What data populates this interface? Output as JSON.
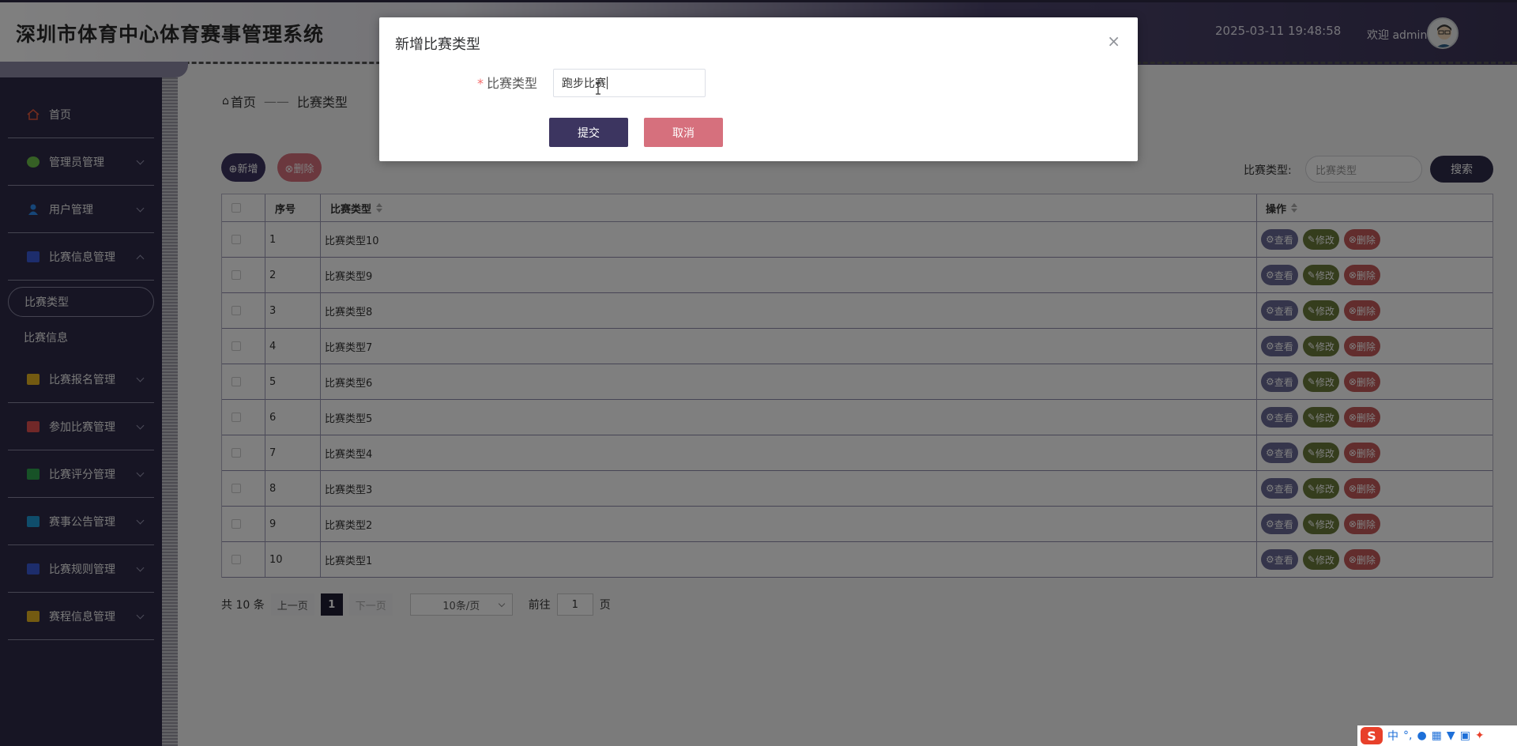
{
  "header": {
    "title": "深圳市体育中心体育赛事管理系统",
    "datetime": "2025-03-11 19:48:58",
    "welcome": "欢迎 admin"
  },
  "sidebar": {
    "items": [
      {
        "label": "首页",
        "icon": "home-icon",
        "color": "#e8593c"
      },
      {
        "label": "管理员管理",
        "icon": "gear-icon",
        "color": "#6cc04a"
      },
      {
        "label": "用户管理",
        "icon": "user-icon",
        "color": "#2d8cf0"
      },
      {
        "label": "比赛信息管理",
        "icon": "grid-icon",
        "color": "#3a5bd9"
      },
      {
        "label": "比赛报名管理",
        "icon": "grid-icon",
        "color": "#e6b422"
      },
      {
        "label": "参加比赛管理",
        "icon": "card-icon",
        "color": "#e35050"
      },
      {
        "label": "比赛评分管理",
        "icon": "card-icon",
        "color": "#2ea44f"
      },
      {
        "label": "赛事公告管理",
        "icon": "chart-icon",
        "color": "#1e9bd6"
      },
      {
        "label": "比赛规则管理",
        "icon": "card-icon",
        "color": "#3a5bd9"
      },
      {
        "label": "赛程信息管理",
        "icon": "folder-icon",
        "color": "#e6b422"
      }
    ],
    "subitems": [
      {
        "label": "比赛类型"
      },
      {
        "label": "比赛信息"
      }
    ]
  },
  "breadcrumb": {
    "home": "首页",
    "separator": "——",
    "current": "比赛类型"
  },
  "toolbar": {
    "add_label": "⊕新增",
    "delete_label": "⊗删除"
  },
  "search": {
    "label": "比赛类型:",
    "placeholder": "比赛类型",
    "button": "搜索"
  },
  "table": {
    "headers": [
      "序号",
      "比赛类型",
      "操作"
    ],
    "rows": [
      {
        "no": "1",
        "type": "比赛类型10"
      },
      {
        "no": "2",
        "type": "比赛类型9"
      },
      {
        "no": "3",
        "type": "比赛类型8"
      },
      {
        "no": "4",
        "type": "比赛类型7"
      },
      {
        "no": "5",
        "type": "比赛类型6"
      },
      {
        "no": "6",
        "type": "比赛类型5"
      },
      {
        "no": "7",
        "type": "比赛类型4"
      },
      {
        "no": "8",
        "type": "比赛类型3"
      },
      {
        "no": "9",
        "type": "比赛类型2"
      },
      {
        "no": "10",
        "type": "比赛类型1"
      }
    ],
    "actions": {
      "view": "查看",
      "edit": "修改",
      "delete": "删除"
    }
  },
  "pagination": {
    "total": "共 10 条",
    "prev": "上一页",
    "current": "1",
    "next": "下一页",
    "page_size": "10条/页",
    "goto_label": "前往",
    "goto_value": "1",
    "page_suffix": "页"
  },
  "dialog": {
    "title": "新增比赛类型",
    "field_label": "比赛类型",
    "required_mark": "*",
    "field_value": "跑步比赛",
    "submit": "提交",
    "cancel": "取消",
    "close": "×"
  },
  "colors": {
    "primary": "#3c3560",
    "danger": "#d6707d",
    "view": "#6b6a96",
    "edit": "#6a7a3a",
    "delete": "#c55b5b"
  },
  "taskbar": {
    "ime_logo": "S",
    "ime_mode": "中"
  }
}
